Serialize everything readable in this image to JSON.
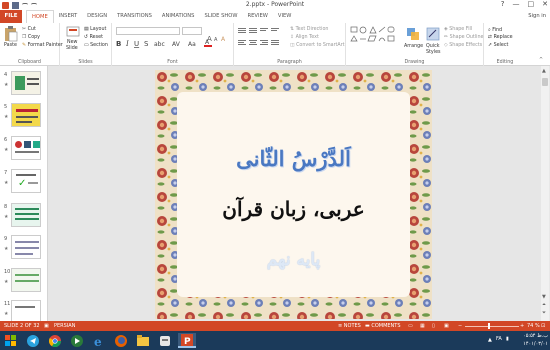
{
  "window": {
    "title": "2.pptx - PowerPoint",
    "controls": [
      "?",
      "—",
      "□",
      "✕"
    ]
  },
  "tabs": {
    "file": "FILE",
    "items": [
      "HOME",
      "INSERT",
      "DESIGN",
      "TRANSITIONS",
      "ANIMATIONS",
      "SLIDE SHOW",
      "REVIEW",
      "VIEW"
    ],
    "active": "HOME",
    "signin": "Sign in"
  },
  "ribbon": {
    "clipboard": {
      "label": "Clipboard",
      "paste": "Paste",
      "cut": "Cut",
      "copy": "Copy",
      "format_painter": "Format Painter"
    },
    "slides": {
      "label": "Slides",
      "new_slide": "New",
      "new_slide2": "Slide",
      "layout": "Layout",
      "reset": "Reset",
      "section": "Section"
    },
    "font": {
      "label": "Font"
    },
    "paragraph": {
      "label": "Paragraph",
      "text_direction": "Text Direction",
      "align_text": "Align Text",
      "smartart": "Convert to SmartArt"
    },
    "drawing": {
      "label": "Drawing",
      "arrange": "Arrange",
      "quick_styles": "Quick",
      "quick_styles2": "Styles",
      "shape_fill": "Shape Fill",
      "shape_outline": "Shape Outline",
      "shape_effects": "Shape Effects"
    },
    "editing": {
      "label": "Editing",
      "find": "Find",
      "replace": "Replace",
      "select": "Select"
    }
  },
  "thumbnails": [
    {
      "num": "4",
      "star": "★"
    },
    {
      "num": "5",
      "star": "★"
    },
    {
      "num": "6",
      "star": "★"
    },
    {
      "num": "7",
      "star": "★"
    },
    {
      "num": "8",
      "star": "★"
    },
    {
      "num": "9",
      "star": "★"
    },
    {
      "num": "10",
      "star": "★"
    },
    {
      "num": "11",
      "star": "★"
    }
  ],
  "slide": {
    "title": "اَلدَّرْسُ الثّانی",
    "subtitle": "عربی، زبان قرآن",
    "grade": "پایه نهم"
  },
  "status": {
    "slide_info": "SLIDE 2 OF 32",
    "language": "PERSIAN",
    "notes": "NOTES",
    "comments": "COMMENTS",
    "zoom": "74 %"
  },
  "tray": {
    "lang": "FA",
    "time": "۰۵:۵۴ ب.ظ",
    "date": "۱۴۰۱/۰۳/۰۱"
  },
  "colors": {
    "accent": "#d24726",
    "taskbar": "#1b3a5a",
    "title_blue": "#4a78c2"
  }
}
